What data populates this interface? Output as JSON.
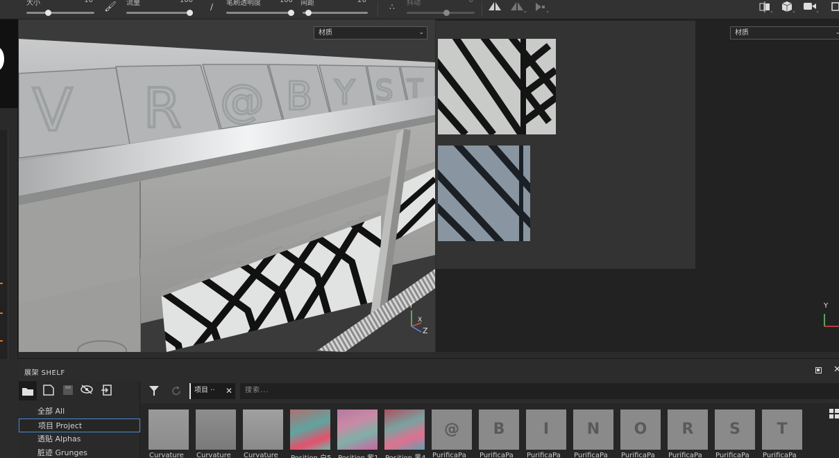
{
  "toolbar": {
    "size_label": "大小",
    "size_value": "10",
    "flow_label": "流量",
    "flow_value": "100",
    "stroke_opacity_label": "笔刷透明度",
    "stroke_opacity_value": "100",
    "spacing_label": "间距",
    "spacing_value": "20",
    "jitter_label": "抖动",
    "jitter_value": "0",
    "size_fill": 0.3,
    "flow_fill": 1.0,
    "stroke_opacity_fill": 1.0,
    "spacing_fill": 0.05,
    "jitter_fill": 0.6
  },
  "viewport3d": {
    "material_select": "材质",
    "axis_y": "Y",
    "axis_x": "X",
    "axis_z": "Z"
  },
  "viewport2d": {
    "material_select": "材质",
    "axis_y": "Y"
  },
  "shelf": {
    "title": "展架 SHELF",
    "categories": [
      {
        "label": "全部 All"
      },
      {
        "label": "项目 Project"
      },
      {
        "label": "透贴 Alphas"
      },
      {
        "label": "脏迹 Grunges"
      }
    ],
    "selected_category": "项目 Project",
    "tag_chip": "项目 ··",
    "search_placeholder": "搜索...",
    "items": [
      {
        "label": "Curvature",
        "kind": "curv1"
      },
      {
        "label": "Curvature",
        "kind": "curv2"
      },
      {
        "label": "Curvature",
        "kind": "curv3"
      },
      {
        "label": "Position 白5",
        "kind": "pos1"
      },
      {
        "label": "Position 紫1",
        "kind": "pos2"
      },
      {
        "label": "Position 黑4",
        "kind": "pos3"
      },
      {
        "label": "PurificaPa",
        "letter": "@"
      },
      {
        "label": "PurificaPa",
        "letter": "B"
      },
      {
        "label": "PurificaPa",
        "letter": "I"
      },
      {
        "label": "PurificaPa",
        "letter": "N"
      },
      {
        "label": "PurificaPa",
        "letter": "O"
      },
      {
        "label": "PurificaPa",
        "letter": "R"
      },
      {
        "label": "PurificaPa",
        "letter": "S"
      },
      {
        "label": "PurificaPa",
        "letter": "T"
      }
    ]
  },
  "colors": {
    "accent_blue": "#4a8bd6",
    "marker_orange": "#e0722a"
  }
}
